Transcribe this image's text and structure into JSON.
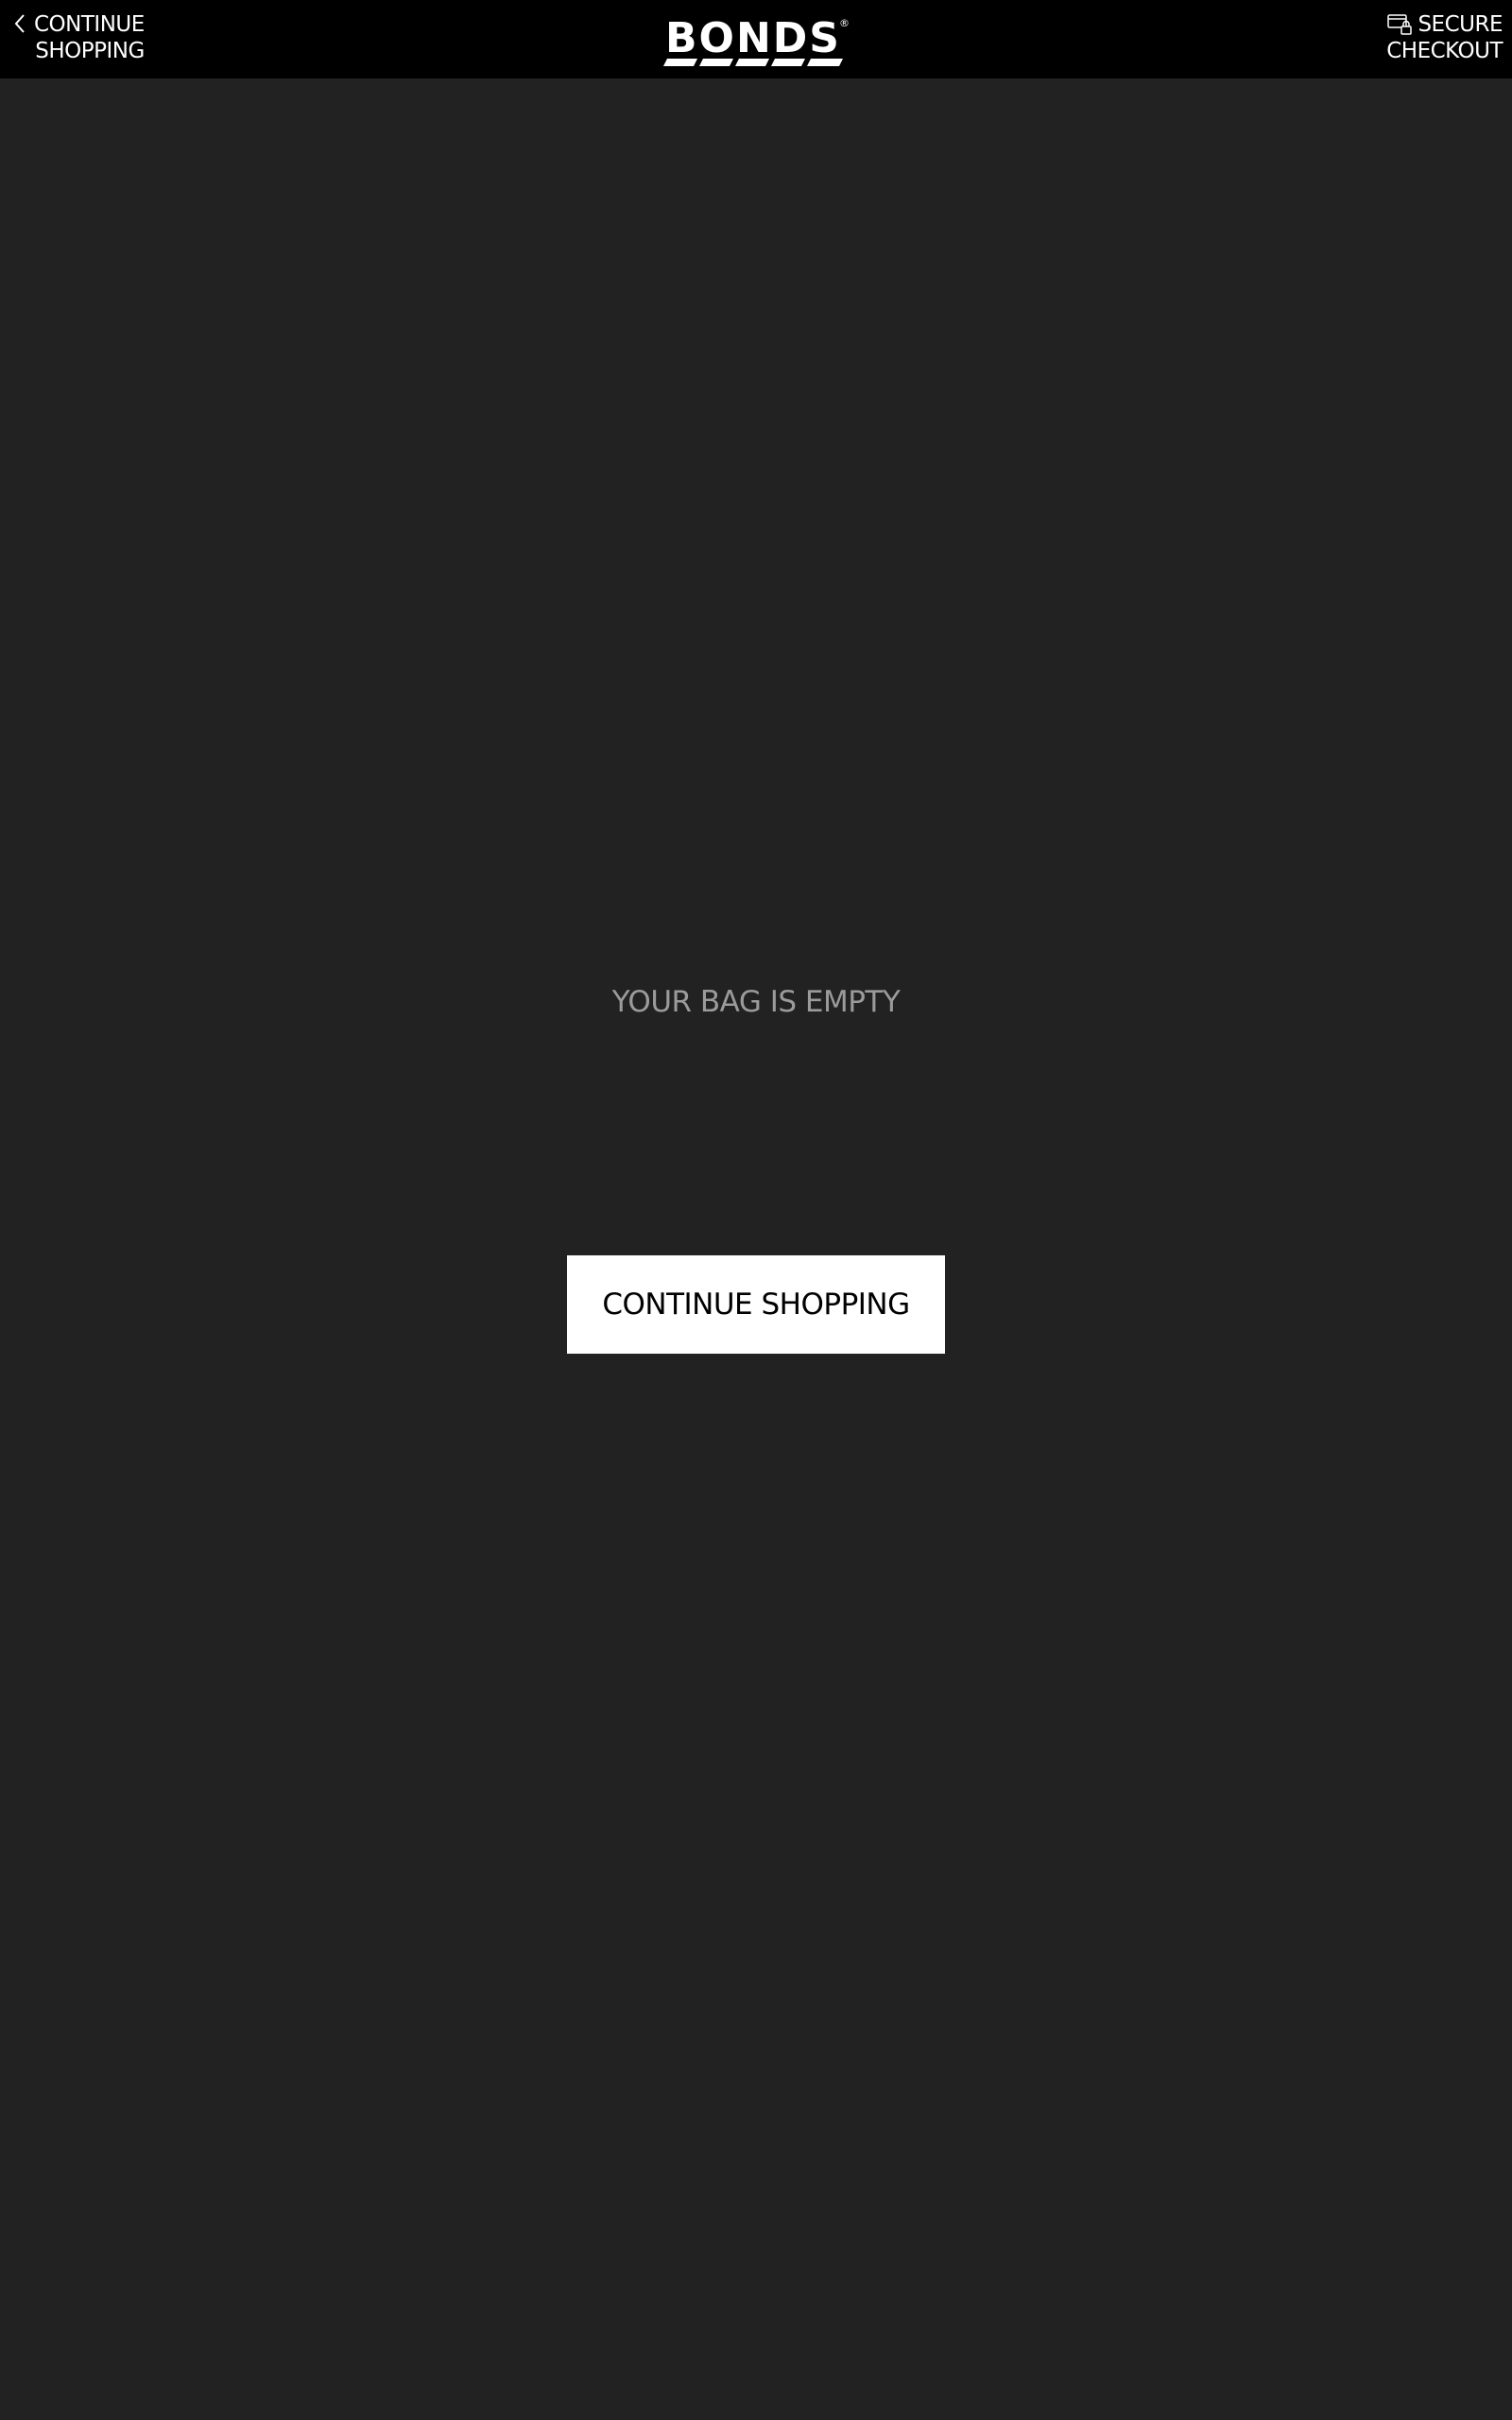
{
  "header": {
    "back_link": {
      "line1": "CONTINUE",
      "line2": "SHOPPING",
      "icon": "chevron-left-icon"
    },
    "logo": {
      "text": "BONDS",
      "registered": "®"
    },
    "secure_checkout": {
      "line1": "SECURE",
      "line2": "CHECKOUT",
      "icon": "card-lock-icon"
    }
  },
  "main": {
    "empty_message": "YOUR BAG IS EMPTY",
    "continue_button_label": "CONTINUE SHOPPING"
  },
  "colors": {
    "header_bg": "#000000",
    "page_bg": "#222222",
    "muted_text": "#9b9b9b",
    "button_bg": "#ffffff"
  }
}
